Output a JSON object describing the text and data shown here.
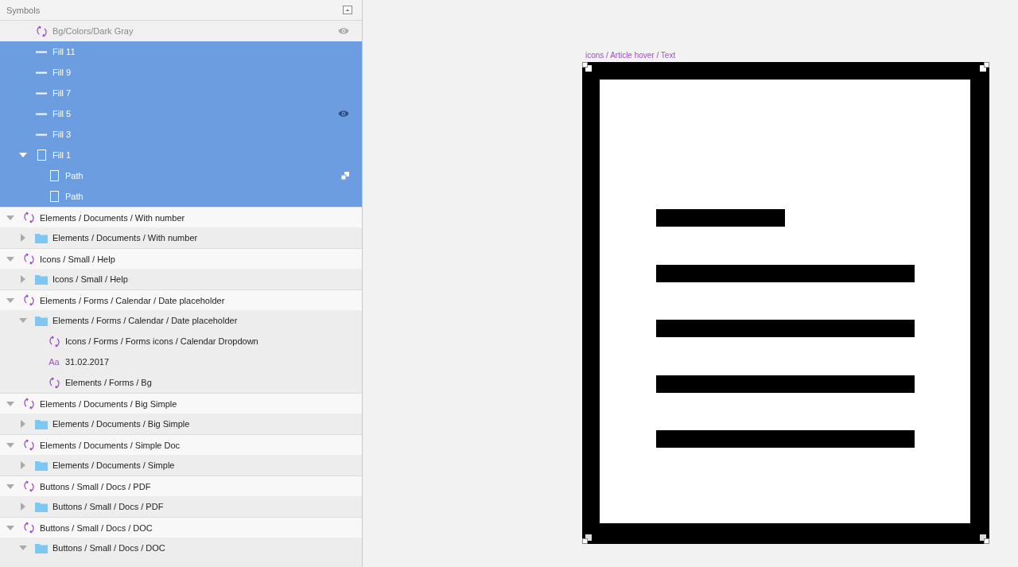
{
  "panel": {
    "title": "Symbols"
  },
  "partial_group": {
    "children": [
      {
        "kind": "symbol",
        "label": "Bg/Colors/Dark Gray",
        "selected": false,
        "hidden": true,
        "eye": true
      },
      {
        "kind": "line",
        "label": "Fill 11",
        "selected": true
      },
      {
        "kind": "line",
        "label": "Fill 9",
        "selected": true
      },
      {
        "kind": "line",
        "label": "Fill 7",
        "selected": true
      },
      {
        "kind": "line",
        "label": "Fill 5",
        "selected": true,
        "eye": true
      },
      {
        "kind": "line",
        "label": "Fill 3",
        "selected": true
      },
      {
        "kind": "rect",
        "label": "Fill 1",
        "selected": true,
        "expanded": true,
        "children": [
          {
            "kind": "rect",
            "label": "Path",
            "selected": true,
            "mask": true
          },
          {
            "kind": "rect",
            "label": "Path",
            "selected": true
          }
        ]
      }
    ]
  },
  "layers": [
    {
      "kind": "symbol",
      "label": "Elements / Documents / With number",
      "selected": false,
      "expanded": true,
      "children": [
        {
          "kind": "folder",
          "label": "Elements / Documents / With number",
          "selected": false,
          "expanded": false
        }
      ]
    },
    {
      "kind": "symbol",
      "label": "Icons / Small / Help",
      "selected": false,
      "expanded": true,
      "children": [
        {
          "kind": "folder",
          "label": "Icons / Small / Help",
          "selected": false,
          "expanded": false
        }
      ]
    },
    {
      "kind": "symbol",
      "label": "Elements / Forms / Calendar / Date placeholder",
      "selected": false,
      "expanded": true,
      "children": [
        {
          "kind": "folder",
          "label": "Elements / Forms / Calendar / Date placeholder",
          "selected": false,
          "expanded": true,
          "children": [
            {
              "kind": "symbol",
              "label": "Icons / Forms / Forms icons / Calendar Dropdown",
              "selected": false
            },
            {
              "kind": "text",
              "glyph": "Aa",
              "label": "31.02.2017",
              "selected": false
            },
            {
              "kind": "symbol",
              "label": "Elements / Forms / Bg",
              "selected": false
            }
          ]
        }
      ]
    },
    {
      "kind": "symbol",
      "label": "Elements / Documents / Big Simple",
      "selected": false,
      "expanded": true,
      "children": [
        {
          "kind": "folder",
          "label": "Elements / Documents / Big Simple",
          "selected": false,
          "expanded": false
        }
      ]
    },
    {
      "kind": "symbol",
      "label": "Elements / Documents / Simple Doc",
      "selected": false,
      "expanded": true,
      "children": [
        {
          "kind": "folder",
          "label": "Elements / Documents / Simple",
          "selected": false,
          "expanded": false
        }
      ]
    },
    {
      "kind": "symbol",
      "label": "Buttons / Small / Docs / PDF",
      "selected": false,
      "expanded": true,
      "children": [
        {
          "kind": "folder",
          "label": "Buttons / Small / Docs / PDF",
          "selected": false,
          "expanded": false
        }
      ]
    },
    {
      "kind": "symbol",
      "label": "Buttons / Small / Docs / DOC",
      "selected": false,
      "expanded": true,
      "children": [
        {
          "kind": "folder",
          "label": "Buttons / Small / Docs / DOC",
          "selected": false,
          "expanded": true
        }
      ]
    }
  ],
  "canvas": {
    "artboard_label": "icons / Article hover / Text"
  }
}
